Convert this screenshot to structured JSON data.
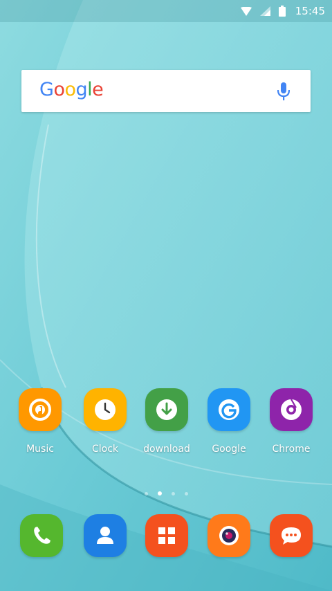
{
  "status_bar": {
    "time": "15:45",
    "icons": [
      "wifi-icon",
      "signal-icon",
      "battery-icon"
    ]
  },
  "search_widget": {
    "logo_text": "Google",
    "logo_colors": [
      "#4285F4",
      "#EA4335",
      "#FBBC05",
      "#4285F4",
      "#34A853",
      "#EA4335"
    ],
    "mic_icon": "mic-icon"
  },
  "home_apps": [
    {
      "label": "Music",
      "icon": "music-icon",
      "color": "#FF9800"
    },
    {
      "label": "Clock",
      "icon": "clock-icon",
      "color": "#FFB300"
    },
    {
      "label": "download",
      "icon": "download-icon",
      "color": "#43A047"
    },
    {
      "label": "Google",
      "icon": "google-g-icon",
      "color": "#2196F3"
    },
    {
      "label": "Chrome",
      "icon": "chrome-icon",
      "color": "#8E24AA"
    }
  ],
  "page_indicator": {
    "count": 4,
    "active_index": 1
  },
  "dock_apps": [
    {
      "icon": "phone-icon",
      "color": "#55B72E"
    },
    {
      "icon": "contacts-icon",
      "color": "#1E7FE3"
    },
    {
      "icon": "apps-grid-icon",
      "color": "#F4511E"
    },
    {
      "icon": "camera-icon",
      "color": "#FF7A1A"
    },
    {
      "icon": "messages-icon",
      "color": "#F4511E"
    }
  ]
}
